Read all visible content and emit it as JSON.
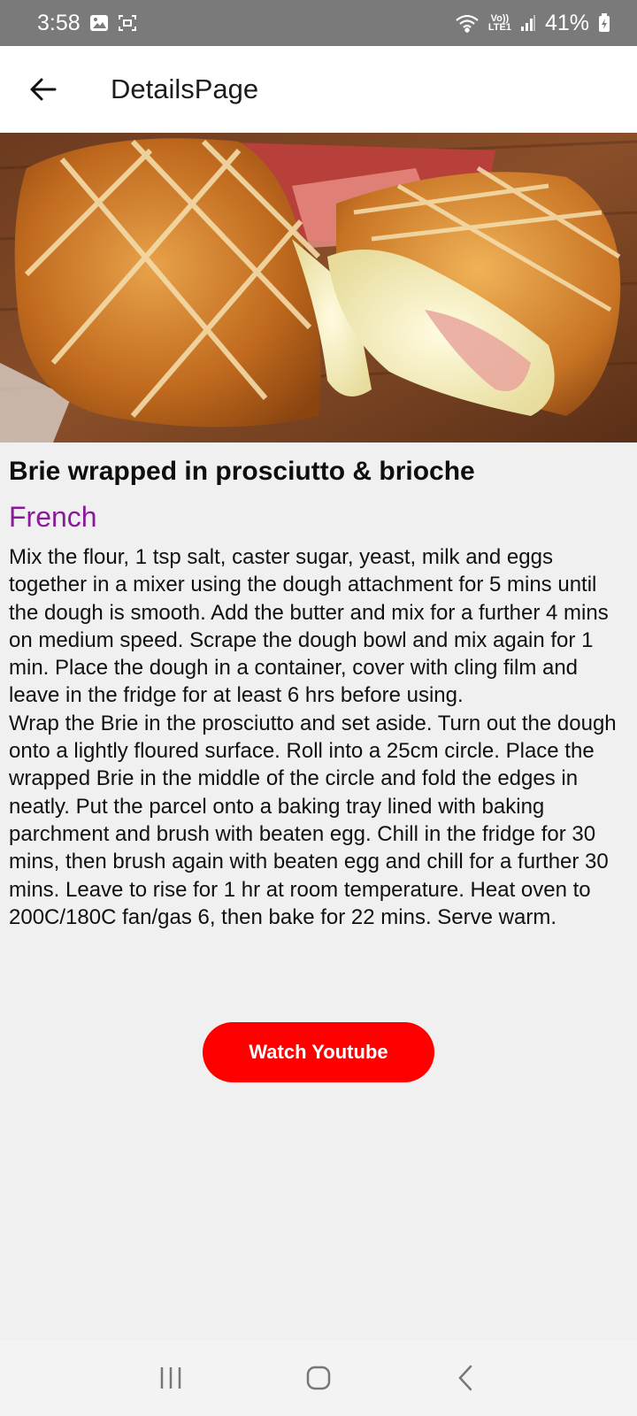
{
  "status_bar": {
    "time": "3:58",
    "network_line1": "Vo))",
    "network_line2": "LTE1",
    "battery": "41%"
  },
  "app_bar": {
    "title": "DetailsPage"
  },
  "recipe": {
    "title": "Brie wrapped in prosciutto & brioche",
    "cuisine": "French",
    "instructions": "Mix the flour, 1 tsp salt, caster sugar, yeast, milk and eggs together in a mixer using the dough attachment for 5 mins until the dough is smooth. Add the butter and mix for a further 4 mins on medium speed. Scrape the dough bowl and mix again for 1 min. Place the dough in a container, cover with cling film and leave in the fridge for at least 6 hrs before using.\nWrap the Brie in the prosciutto and set aside. Turn out the dough onto a lightly floured surface. Roll into a 25cm circle. Place the wrapped Brie in the middle of the circle and fold the edges in neatly. Put the parcel onto a baking tray lined with baking parchment and brush with beaten egg. Chill in the fridge for 30 mins, then brush again with beaten egg and chill for a further 30 mins. Leave to rise for 1 hr at room temperature. Heat oven to 200C/180C fan/gas 6, then bake for 22 mins. Serve warm."
  },
  "actions": {
    "watch_youtube": "Watch Youtube"
  },
  "colors": {
    "status_bar": "#7a7a7a",
    "cuisine_text": "#8b1a9a",
    "youtube_button": "#ff0000"
  },
  "icons": {
    "back": "arrow-left-icon",
    "gallery": "image-icon",
    "screenshot": "screen-capture-icon",
    "wifi": "wifi-icon",
    "signal": "signal-icon",
    "battery": "battery-icon",
    "recents": "recents-icon",
    "home": "home-icon",
    "nav_back": "chevron-left-icon"
  }
}
